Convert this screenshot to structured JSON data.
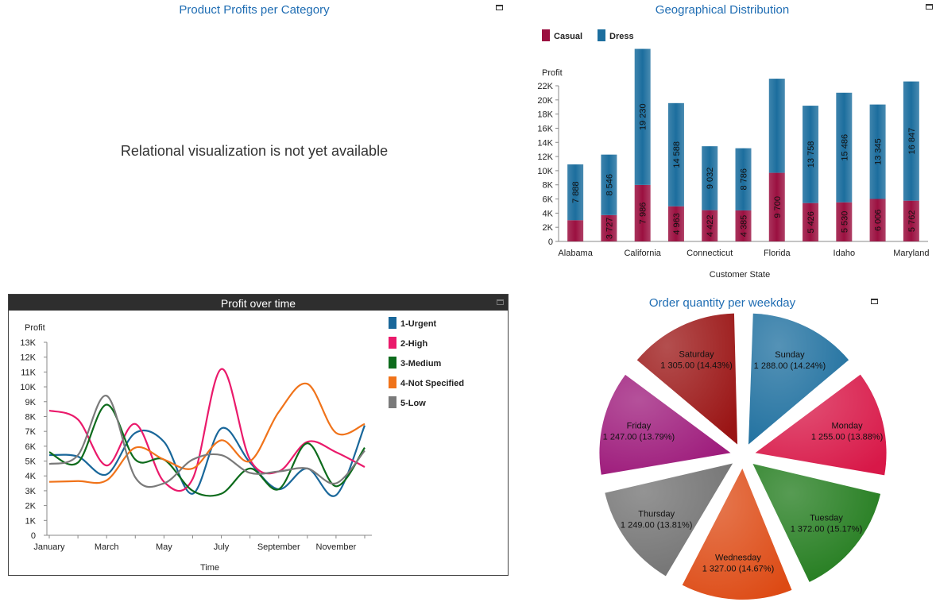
{
  "panels": {
    "profits_category": {
      "title": "Product Profits per Category",
      "message": "Relational visualization is not yet available"
    },
    "geo": {
      "title": "Geographical Distribution"
    },
    "profit_time": {
      "title": "Profit over time"
    },
    "weekday": {
      "title": "Order quantity per weekday"
    }
  },
  "chart_data": [
    {
      "type": "bar",
      "stacked": true,
      "title": "Geographical Distribution",
      "xlabel": "Customer State",
      "ylabel": "Profit",
      "ylim": [
        0,
        22000
      ],
      "yticks": [
        "0",
        "2K",
        "4K",
        "6K",
        "8K",
        "10K",
        "12K",
        "14K",
        "16K",
        "18K",
        "20K",
        "22K"
      ],
      "categories": [
        "Alabama",
        "",
        "California",
        "",
        "Connecticut",
        "",
        "Florida",
        "",
        "Idaho",
        "",
        "Maryland"
      ],
      "legend_position": "top-left",
      "series": [
        {
          "name": "Casual",
          "color": "#9b1040",
          "values": [
            3000,
            3727,
            7986,
            4963,
            4422,
            4385,
            9700,
            5426,
            5530,
            6006,
            5762
          ],
          "labels": [
            "",
            "3 727",
            "7 986",
            "4 963",
            "4 422",
            "4 385",
            "9 700",
            "5 426",
            "5 530",
            "6 006",
            "5 762"
          ]
        },
        {
          "name": "Dress",
          "color": "#1c6e9e",
          "values": [
            7888,
            8546,
            19230,
            14588,
            9032,
            8786,
            13300,
            13758,
            15486,
            13345,
            16847
          ],
          "labels": [
            "7 888",
            "8 546",
            "19 230",
            "14 588",
            "9 032",
            "8 786",
            "",
            "13 758",
            "15 486",
            "13 345",
            "16 847"
          ]
        }
      ]
    },
    {
      "type": "line",
      "title": "Profit over time",
      "xlabel": "Time",
      "ylabel": "Profit",
      "ylim": [
        0,
        13000
      ],
      "yticks": [
        "0",
        "1K",
        "2K",
        "3K",
        "4K",
        "5K",
        "6K",
        "7K",
        "8K",
        "9K",
        "10K",
        "11K",
        "12K",
        "13K"
      ],
      "x": [
        "January",
        "February",
        "March",
        "April",
        "May",
        "June",
        "July",
        "August",
        "September",
        "October",
        "November",
        "December"
      ],
      "xticks": [
        "January",
        "March",
        "May",
        "July",
        "September",
        "November"
      ],
      "legend_position": "right",
      "series": [
        {
          "name": "1-Urgent",
          "color": "#19679a",
          "values": [
            5400,
            5300,
            4100,
            6900,
            6300,
            2800,
            7200,
            4900,
            3100,
            4500,
            2700,
            7400
          ]
        },
        {
          "name": "2-High",
          "color": "#ea1a6b",
          "values": [
            8400,
            7800,
            4700,
            7500,
            3600,
            3800,
            11200,
            5100,
            4300,
            6300,
            5600,
            4600
          ]
        },
        {
          "name": "3-Medium",
          "color": "#0d6b1c",
          "values": [
            5600,
            4900,
            8800,
            5100,
            5100,
            3000,
            2800,
            4500,
            3100,
            6200,
            3300,
            5900
          ]
        },
        {
          "name": "4-Not Specified",
          "color": "#f0731a",
          "values": [
            3600,
            3650,
            3700,
            5900,
            5100,
            4500,
            6400,
            5000,
            8300,
            10200,
            6900,
            7500
          ]
        },
        {
          "name": "5-Low",
          "color": "#7a7a7a",
          "values": [
            4800,
            5400,
            9400,
            3900,
            3500,
            5100,
            5400,
            4200,
            4300,
            4500,
            3500,
            5700
          ]
        }
      ]
    },
    {
      "type": "pie",
      "title": "Order quantity per weekday",
      "slices": [
        {
          "name": "Sunday",
          "value": 1288.0,
          "label": "1 288.00 (14.24%)",
          "color": "#1c6e9e"
        },
        {
          "name": "Monday",
          "value": 1255.0,
          "label": "1 255.00 (13.88%)",
          "color": "#d81848"
        },
        {
          "name": "Tuesday",
          "value": 1372.0,
          "label": "1 372.00 (15.17%)",
          "color": "#1f7a1a"
        },
        {
          "name": "Wednesday",
          "value": 1327.0,
          "label": "1 327.00 (14.67%)",
          "color": "#dd4a14"
        },
        {
          "name": "Thursday",
          "value": 1249.0,
          "label": "1 249.00 (13.81%)",
          "color": "#707070"
        },
        {
          "name": "Friday",
          "value": 1247.0,
          "label": "1 247.00 (13.79%)",
          "color": "#9c1779"
        },
        {
          "name": "Saturday",
          "value": 1305.0,
          "label": "1 305.00 (14.43%)",
          "color": "#9a1414"
        }
      ]
    }
  ]
}
